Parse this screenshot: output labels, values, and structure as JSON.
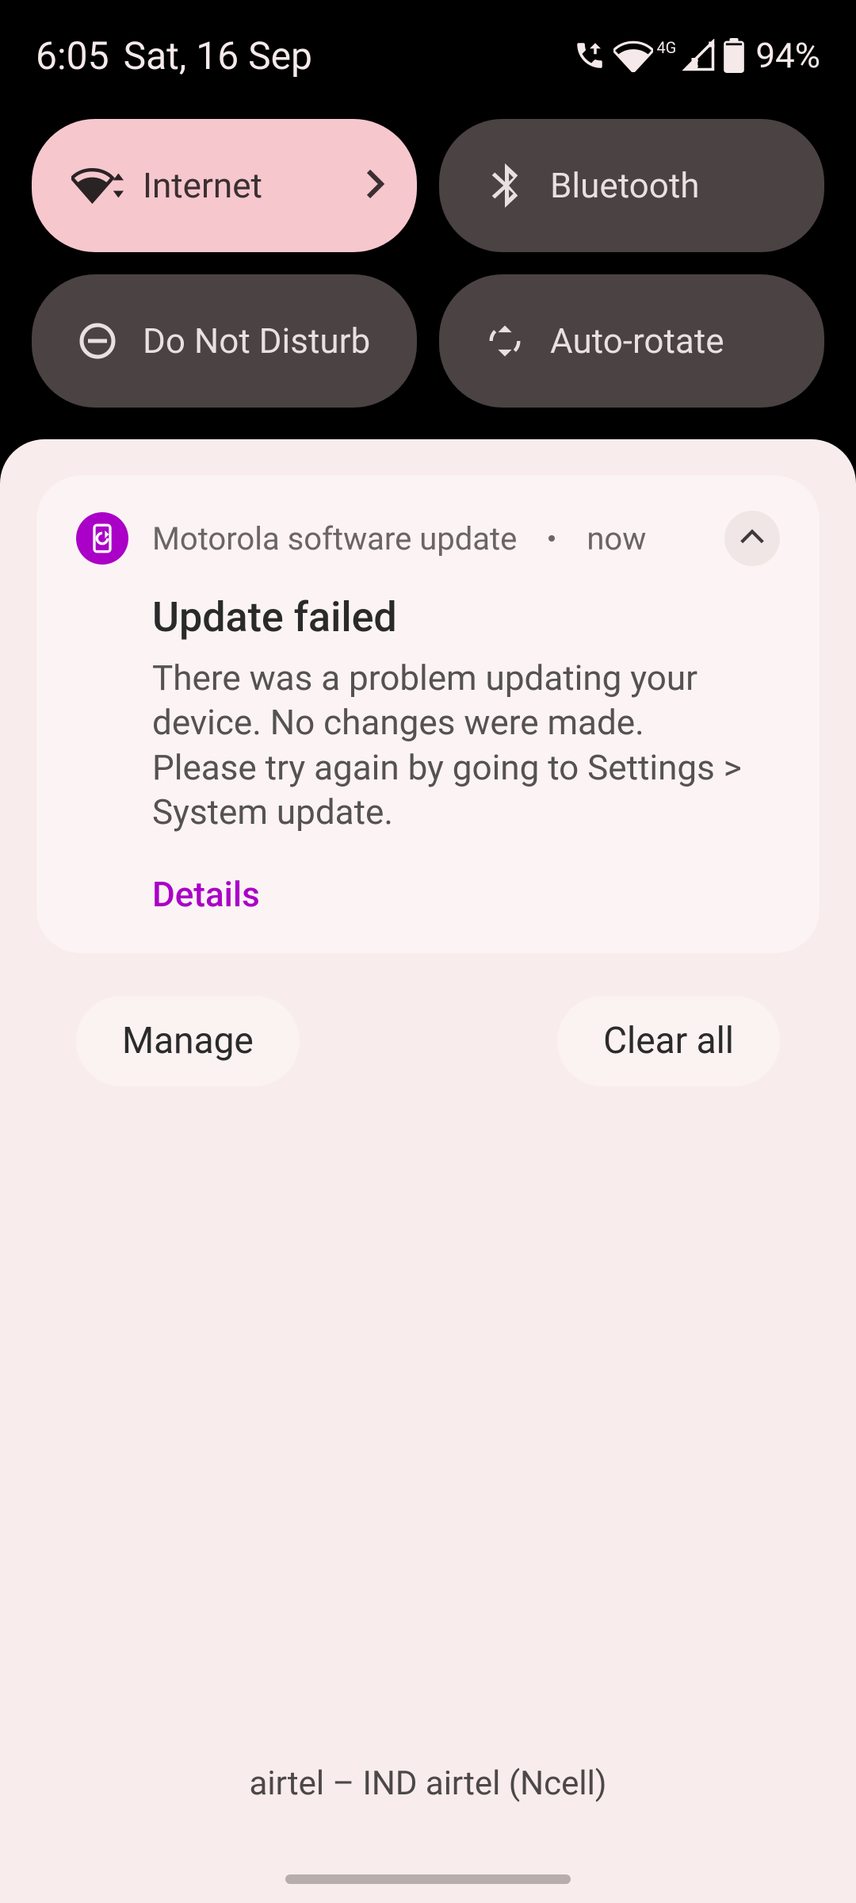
{
  "status": {
    "time": "6:05",
    "date": "Sat, 16 Sep",
    "network_type": "4G",
    "battery": "94%"
  },
  "qs": {
    "internet": "Internet",
    "bluetooth": "Bluetooth",
    "dnd": "Do Not Disturb",
    "autorotate": "Auto-rotate"
  },
  "notification": {
    "source": "Motorola software update",
    "time": "now",
    "title": "Update failed",
    "body": "There was a problem updating your device. No changes were made.\nPlease try again by going to Settings > System update.",
    "action": "Details"
  },
  "shade_actions": {
    "manage": "Manage",
    "clear_all": "Clear all"
  },
  "carrier": "airtel – IND airtel (Ncell)"
}
